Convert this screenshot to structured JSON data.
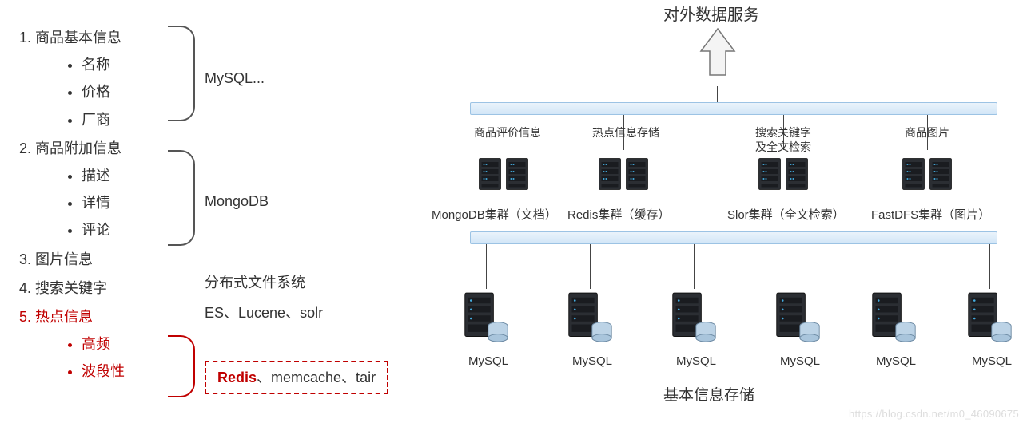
{
  "outline": {
    "items": [
      {
        "title": "商品基本信息",
        "sub": [
          "名称",
          "价格",
          "厂商"
        ],
        "tech": "MySQL..."
      },
      {
        "title": "商品附加信息",
        "sub": [
          "描述",
          "详情",
          "评论"
        ],
        "tech": "MongoDB"
      },
      {
        "title": "图片信息",
        "sub": [],
        "tech": "分布式文件系统"
      },
      {
        "title": "搜索关键字",
        "sub": [],
        "tech": "ES、Lucene、solr"
      },
      {
        "title": "热点信息",
        "sub": [
          "高频",
          "波段性"
        ],
        "tech_rich": {
          "highlight": "Redis",
          "rest": "、memcache、tair"
        },
        "hot": true
      }
    ]
  },
  "arch": {
    "top_title": "对外数据服务",
    "clusters": [
      {
        "top_label": "商品评价信息",
        "sub_label": "MongoDB集群（文档）"
      },
      {
        "top_label": "热点信息存储",
        "sub_label": "Redis集群（缓存）"
      },
      {
        "top_label": "搜索关键字\n及全文检索",
        "sub_label": "Slor集群（全文检索）"
      },
      {
        "top_label": "商品图片",
        "sub_label": "FastDFS集群（图片）"
      }
    ],
    "db_nodes": [
      "MySQL",
      "MySQL",
      "MySQL",
      "MySQL",
      "MySQL",
      "MySQL"
    ],
    "bottom_title": "基本信息存储"
  },
  "watermark": "https://blog.csdn.net/m0_46090675"
}
